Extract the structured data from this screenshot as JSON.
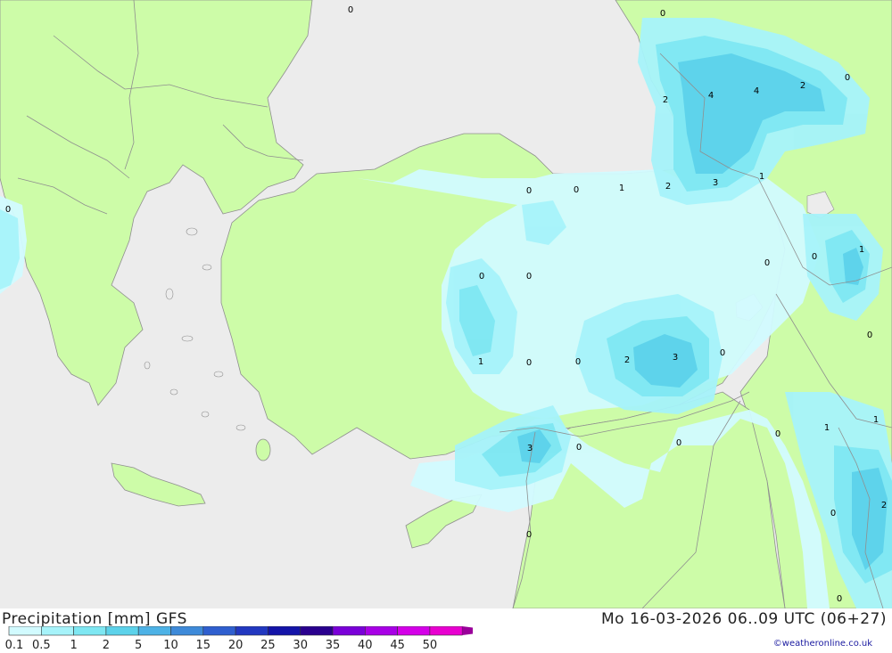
{
  "title": "Precipitation [mm] GFS",
  "valid_time": "Mo 16-03-2026 06..09 UTC (06+27)",
  "credit": "©weatheronline.co.uk",
  "colors": {
    "sea": "#ececec",
    "land": "#cdfca8",
    "border": "#8f8f8f",
    "precip_0_1": "#d2fbff",
    "precip_0_5": "#a6f3fa",
    "precip_1": "#7ee7f2",
    "precip_2": "#5cd2ea"
  },
  "legend": {
    "labels": [
      "0.1",
      "0.5",
      "1",
      "2",
      "5",
      "10",
      "15",
      "20",
      "25",
      "30",
      "35",
      "40",
      "45",
      "50"
    ],
    "colors": [
      "#d2fbff",
      "#a6f3fa",
      "#7ee7f2",
      "#5cd2ea",
      "#4db2e6",
      "#3e8ad9",
      "#2f5fcf",
      "#2238c0",
      "#1414a8",
      "#2a008e",
      "#7a00d8",
      "#a800e6",
      "#d400e8",
      "#e800d0"
    ]
  },
  "values": [
    "0",
    "0",
    "0",
    "2",
    "4",
    "4",
    "2",
    "0",
    "0",
    "0",
    "1",
    "2",
    "3",
    "1",
    "0",
    "0",
    "0",
    "1",
    "0",
    "0",
    "0",
    "2",
    "3",
    "0",
    "0",
    "1",
    "0",
    "0",
    "3",
    "0",
    "0",
    "0",
    "1",
    "1",
    "2",
    "0"
  ]
}
